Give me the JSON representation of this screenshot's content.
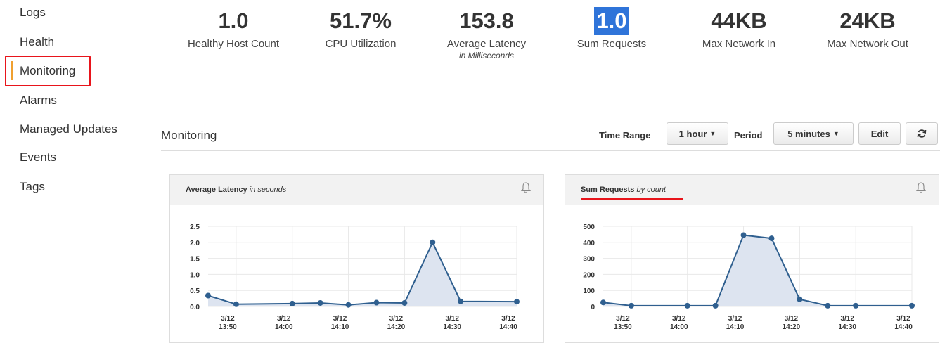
{
  "sidebar": {
    "items": [
      {
        "label": "Logs"
      },
      {
        "label": "Health"
      },
      {
        "label": "Monitoring"
      },
      {
        "label": "Alarms"
      },
      {
        "label": "Managed Updates"
      },
      {
        "label": "Events"
      },
      {
        "label": "Tags"
      }
    ],
    "active_index": 2
  },
  "metrics": [
    {
      "value": "1.0",
      "label": "Healthy Host Count",
      "sub": ""
    },
    {
      "value": "51.7%",
      "label": "CPU Utilization",
      "sub": ""
    },
    {
      "value": "153.8",
      "label": "Average Latency",
      "sub": "in Milliseconds"
    },
    {
      "value": "1.0",
      "label": "Sum Requests",
      "sub": "",
      "highlighted": true
    },
    {
      "value": "44KB",
      "label": "Max Network In",
      "sub": ""
    },
    {
      "value": "24KB",
      "label": "Max Network Out",
      "sub": ""
    }
  ],
  "monitoring": {
    "title": "Monitoring",
    "time_range_label": "Time Range",
    "time_range_value": "1 hour",
    "period_label": "Period",
    "period_value": "5 minutes",
    "edit_label": "Edit",
    "refresh_icon": "refresh-icon"
  },
  "colors": {
    "accent_orange": "#f0a030",
    "annotation_red": "#e8141b",
    "line": "#2f5f8f",
    "fill": "#dde4f0",
    "highlight": "#2f74d9"
  },
  "chart_data": [
    {
      "type": "area",
      "title": "Average Latency",
      "title_suffix": "in seconds",
      "x": [
        "13:45",
        "13:50",
        "14:00",
        "14:05",
        "14:10",
        "14:15",
        "14:20",
        "14:25",
        "14:30",
        "14:40"
      ],
      "y": [
        0.34,
        0.07,
        0.09,
        0.11,
        0.05,
        0.12,
        0.11,
        2.0,
        0.16,
        0.15
      ],
      "ylim": [
        0,
        2.5
      ],
      "yticks": [
        "0.0",
        "0.5",
        "1.0",
        "1.5",
        "2.0",
        "2.5"
      ],
      "xticks": [
        {
          "t": "13:50",
          "d": "3/12",
          "l": "13:50"
        },
        {
          "t": "14:00",
          "d": "3/12",
          "l": "14:00"
        },
        {
          "t": "14:10",
          "d": "3/12",
          "l": "14:10"
        },
        {
          "t": "14:20",
          "d": "3/12",
          "l": "14:20"
        },
        {
          "t": "14:30",
          "d": "3/12",
          "l": "14:30"
        },
        {
          "t": "14:40",
          "d": "3/12",
          "l": "14:40"
        }
      ],
      "xlim": [
        "13:45",
        "14:40"
      ],
      "grid": true
    },
    {
      "type": "area",
      "title": "Sum Requests",
      "title_suffix": "by count",
      "x": [
        "13:45",
        "13:50",
        "14:00",
        "14:05",
        "14:10",
        "14:15",
        "14:20",
        "14:25",
        "14:30",
        "14:40"
      ],
      "y": [
        25,
        5,
        5,
        5,
        445,
        425,
        45,
        5,
        5,
        5
      ],
      "ylim": [
        0,
        500
      ],
      "yticks": [
        "0",
        "100",
        "200",
        "300",
        "400",
        "500"
      ],
      "xticks": [
        {
          "t": "13:50",
          "d": "3/12",
          "l": "13:50"
        },
        {
          "t": "14:00",
          "d": "3/12",
          "l": "14:00"
        },
        {
          "t": "14:10",
          "d": "3/12",
          "l": "14:10"
        },
        {
          "t": "14:20",
          "d": "3/12",
          "l": "14:20"
        },
        {
          "t": "14:30",
          "d": "3/12",
          "l": "14:30"
        },
        {
          "t": "14:40",
          "d": "3/12",
          "l": "14:40"
        }
      ],
      "xlim": [
        "13:45",
        "14:40"
      ],
      "grid": true
    }
  ]
}
